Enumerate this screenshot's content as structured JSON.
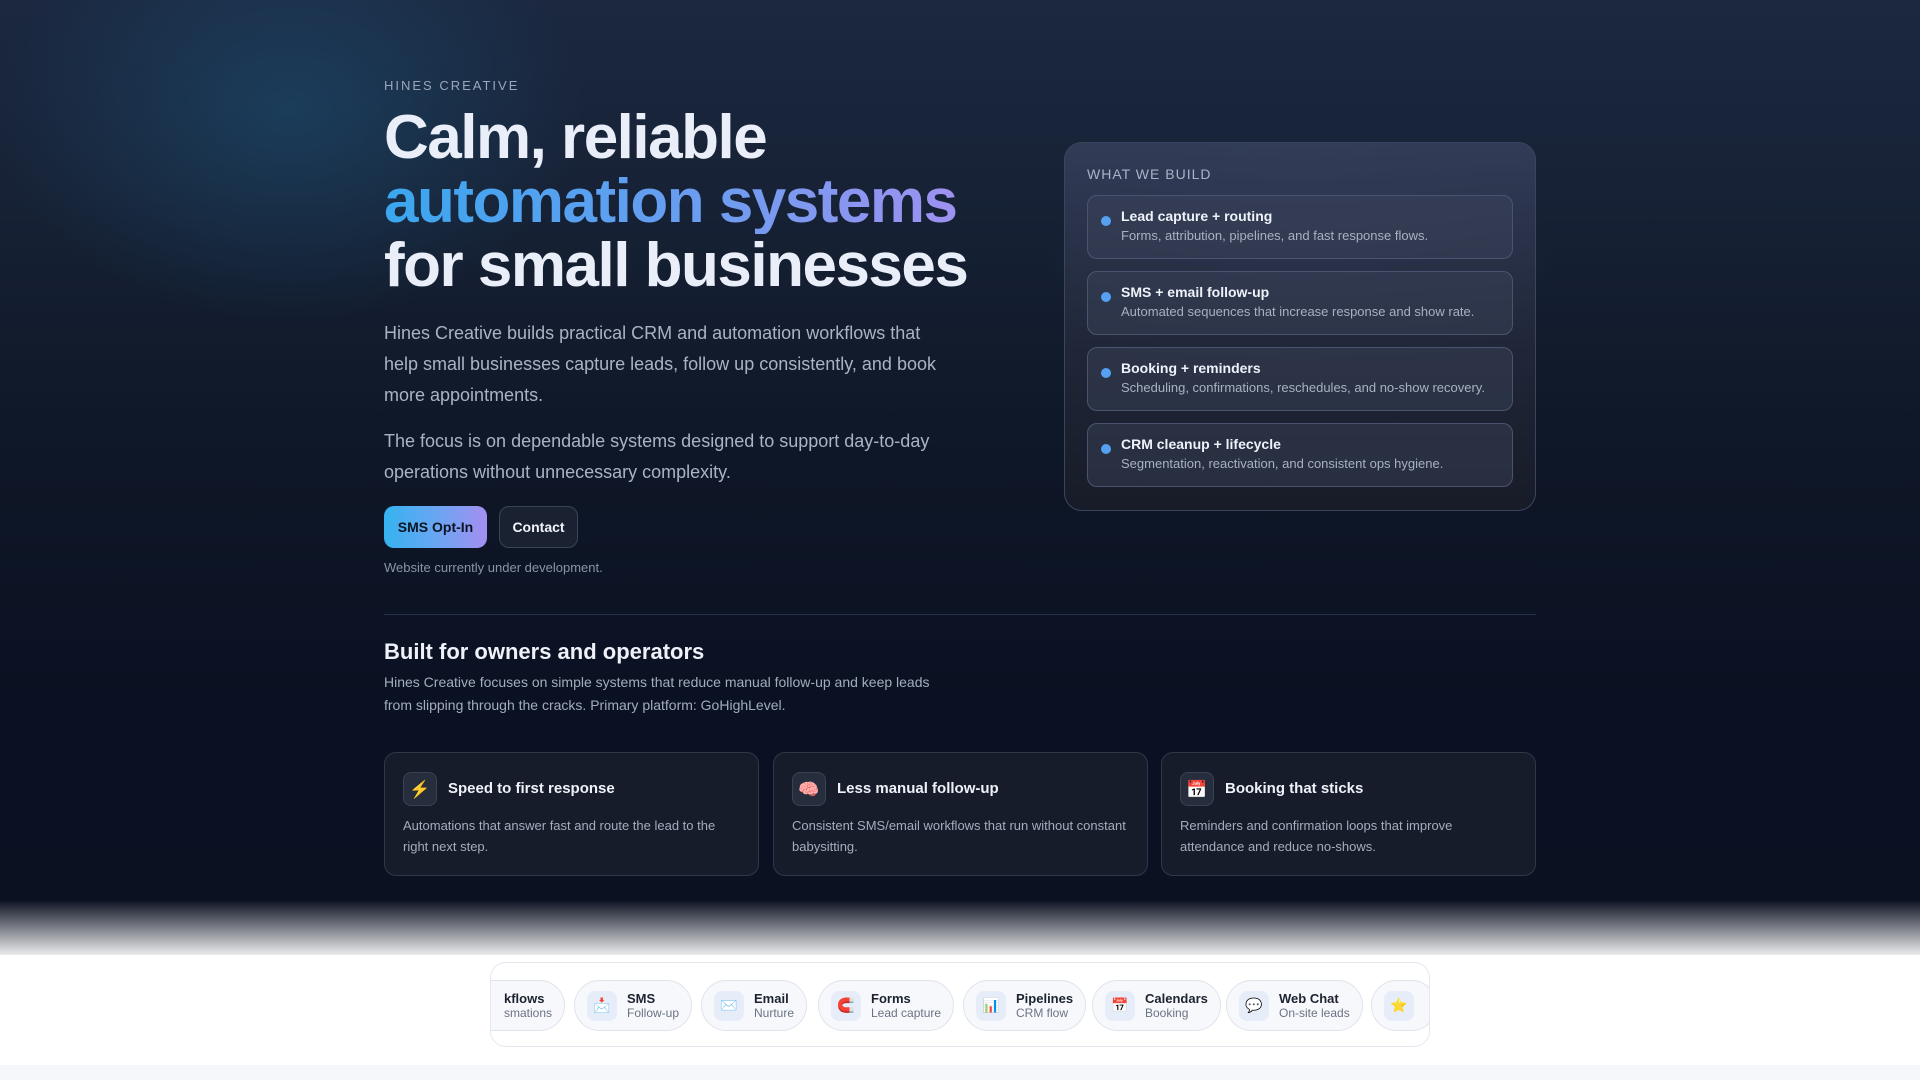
{
  "brand": {
    "eyebrow": "HINES CREATIVE"
  },
  "hero": {
    "headline_line1": "Calm, reliable",
    "headline_line2": "automation systems",
    "headline_line3": "for small businesses",
    "paragraph1": "Hines Creative builds practical CRM and automation workflows that help small businesses capture leads, follow up consistently, and book more appointments.",
    "paragraph2": "The focus is on dependable systems designed to support day-to-day operations without unnecessary complexity.",
    "sms_button": "SMS Opt-In",
    "contact_button": "Contact",
    "dev_note": "Website currently under development."
  },
  "what_we_build": {
    "title": "WHAT WE BUILD",
    "items": [
      {
        "title": "Lead capture + routing",
        "desc": "Forms, attribution, pipelines, and fast response flows."
      },
      {
        "title": "SMS + email follow-up",
        "desc": "Automated sequences that increase response and show rate."
      },
      {
        "title": "Booking + reminders",
        "desc": "Scheduling, confirmations, reschedules, and no-show recovery."
      },
      {
        "title": "CRM cleanup + lifecycle",
        "desc": "Segmentation, reactivation, and consistent ops hygiene."
      }
    ]
  },
  "section": {
    "title": "Built for owners and operators",
    "desc": "Hines Creative focuses on simple systems that reduce manual follow-up and keep leads from slipping through the cracks. Primary platform: GoHighLevel."
  },
  "cards": [
    {
      "icon": "lightning-icon",
      "glyph": "⚡",
      "title": "Speed to first response",
      "desc": "Automations that answer fast and route the lead to the right next step."
    },
    {
      "icon": "brain-icon",
      "glyph": "🧠",
      "title": "Less manual follow-up",
      "desc": "Consistent SMS/email workflows that run without constant babysitting."
    },
    {
      "icon": "calendar-icon",
      "glyph": "📅",
      "title": "Booking that sticks",
      "desc": "Reminders and confirmation loops that improve attendance and reduce no-shows."
    }
  ],
  "ticker": {
    "chips": [
      {
        "label": "kflows",
        "sub": "smations",
        "icon": ""
      },
      {
        "label": "SMS",
        "sub": "Follow-up",
        "icon": "sms-icon",
        "glyph": "📩"
      },
      {
        "label": "Email",
        "sub": "Nurture",
        "icon": "email-icon",
        "glyph": "✉️"
      },
      {
        "label": "Forms",
        "sub": "Lead capture",
        "icon": "magnet-icon",
        "glyph": "🧲"
      },
      {
        "label": "Pipelines",
        "sub": "CRM flow",
        "icon": "chart-icon",
        "glyph": "📊"
      },
      {
        "label": "Calendars",
        "sub": "Booking",
        "icon": "calendar-icon",
        "glyph": "📅"
      },
      {
        "label": "Web Chat",
        "sub": "On-site leads",
        "icon": "chat-icon",
        "glyph": "💬"
      },
      {
        "label": "",
        "sub": "",
        "icon": "star-icon",
        "glyph": "⭐"
      }
    ]
  }
}
